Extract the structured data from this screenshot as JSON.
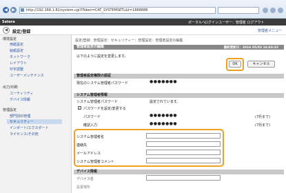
{
  "browser": {
    "url": "http://192.168.1.82/system.cgi?iToken=CAT_SYSTEMSETL&t=1888888"
  },
  "topbar": {
    "brand": "Satera",
    "portal": "ポータルへ",
    "user": "ログインユーザー：管理者 ログアウト"
  },
  "header": {
    "title": "設定/登録",
    "top_link": "管理者メニュー"
  },
  "sidebar": {
    "groups": [
      {
        "label": "環境設定",
        "items": [
          "用紙設定",
          "給紙設定",
          "ネットワーク",
          "レイアウト",
          "印字調整",
          "ユーザーメンテナンス"
        ]
      },
      {
        "label": "出力/印刷",
        "items": [
          "ユーティリティ",
          "デバイス情報"
        ]
      },
      {
        "label": "管理設定",
        "items": [
          "部門別ID管理",
          "セキュリティー",
          "インポート/エクスポート",
          "ライセンス/その他"
        ]
      }
    ],
    "selected": "セキュリティー"
  },
  "main": {
    "breadcrumb": "設定/登録：管理設定：セキュリティー：管理設定：管理者設定の編集",
    "edit_title": "管理者設定の編集",
    "last_updated": "最終更新日：2016 05/03 16:03:32",
    "confirm_msg": "以下のように設定を変更します。",
    "ok_label": "OK",
    "cancel_label": "キャンセル",
    "auth_title": "管理者設定権限の認証",
    "current_pw_label": "現在のシステム管理者パスワード",
    "current_pw_value": "●●●●●●●",
    "sys_mgr_title": "システム管理者情報",
    "sys_pw_label": "システム管理者パスワード",
    "sys_pw_status": "設定されています。",
    "change_pw_label": "パスワードを設定/変更する",
    "password_label": "パスワード",
    "password_value": "●●●●●●●",
    "password_hint": "(7桁まで)",
    "confirm_label": "確認入力",
    "confirm_value": "●●●●●●●",
    "confirm_hint": "(7桁まで)",
    "name_label": "システム管理者名",
    "contact_label": "連絡先",
    "email_label": "メールアドレス",
    "comment_label": "システム管理者コメント",
    "device_title": "デバイス情報",
    "device_name_label": "デバイス名",
    "device_loc_label": "設置場所"
  }
}
